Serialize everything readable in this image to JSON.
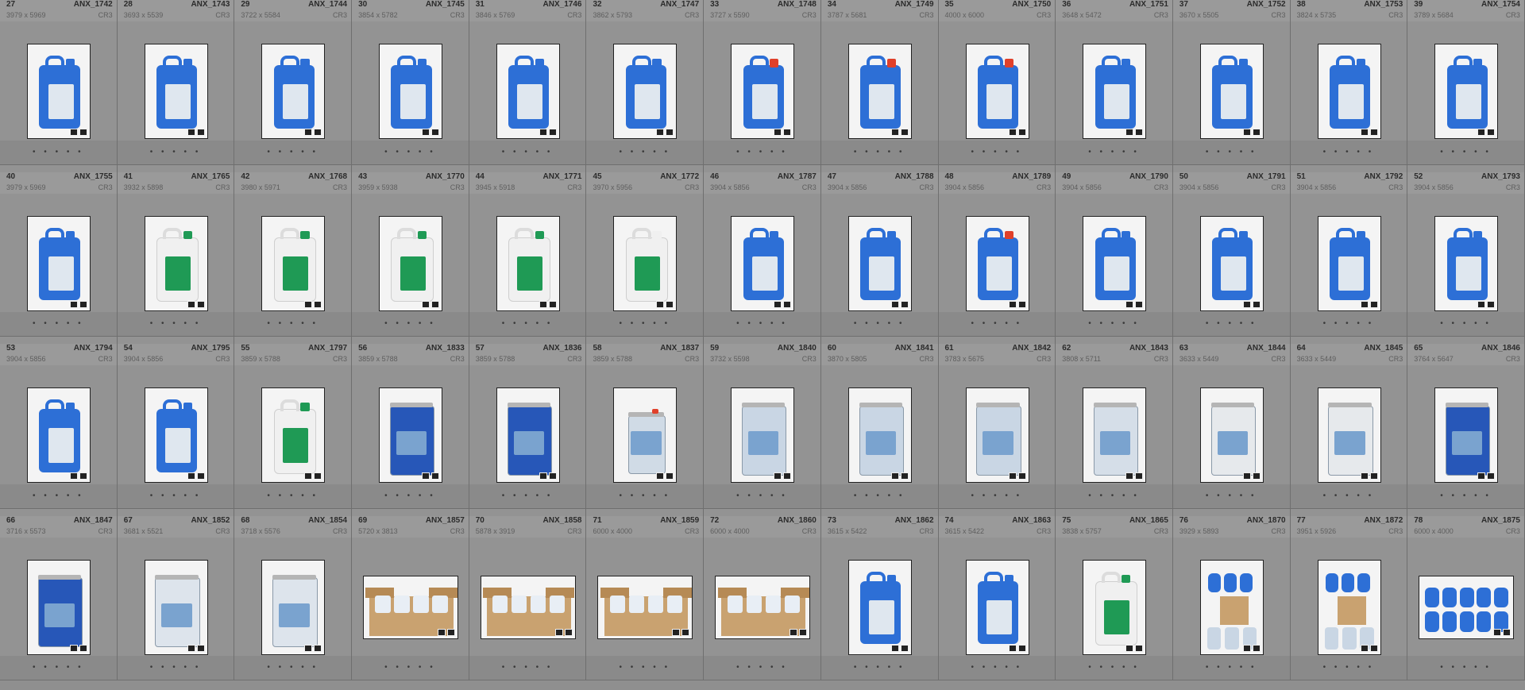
{
  "items": [
    {
      "num": "27",
      "file": "ANX_1742",
      "dims": "3979 x 5969",
      "ext": "CR3",
      "kind": "canister",
      "color": "#2d6fd6",
      "cap": "#2d6fd6",
      "orient": "portrait"
    },
    {
      "num": "28",
      "file": "ANX_1743",
      "dims": "3693 x 5539",
      "ext": "CR3",
      "kind": "canister",
      "color": "#2d6fd6",
      "cap": "#2d6fd6",
      "orient": "portrait"
    },
    {
      "num": "29",
      "file": "ANX_1744",
      "dims": "3722 x 5584",
      "ext": "CR3",
      "kind": "canister",
      "color": "#2d6fd6",
      "cap": "#2d6fd6",
      "orient": "portrait"
    },
    {
      "num": "30",
      "file": "ANX_1745",
      "dims": "3854 x 5782",
      "ext": "CR3",
      "kind": "canister",
      "color": "#2d6fd6",
      "cap": "#2d6fd6",
      "orient": "portrait"
    },
    {
      "num": "31",
      "file": "ANX_1746",
      "dims": "3846 x 5769",
      "ext": "CR3",
      "kind": "canister",
      "color": "#2d6fd6",
      "cap": "#2d6fd6",
      "orient": "portrait"
    },
    {
      "num": "32",
      "file": "ANX_1747",
      "dims": "3862 x 5793",
      "ext": "CR3",
      "kind": "canister",
      "color": "#2d6fd6",
      "cap": "#2d6fd6",
      "orient": "portrait"
    },
    {
      "num": "33",
      "file": "ANX_1748",
      "dims": "3727 x 5590",
      "ext": "CR3",
      "kind": "canister",
      "color": "#2d6fd6",
      "cap": "#e0402a",
      "orient": "portrait"
    },
    {
      "num": "34",
      "file": "ANX_1749",
      "dims": "3787 x 5681",
      "ext": "CR3",
      "kind": "canister",
      "color": "#2d6fd6",
      "cap": "#e0402a",
      "orient": "portrait"
    },
    {
      "num": "35",
      "file": "ANX_1750",
      "dims": "4000 x 6000",
      "ext": "CR3",
      "kind": "canister",
      "color": "#2d6fd6",
      "cap": "#e0402a",
      "orient": "portrait"
    },
    {
      "num": "36",
      "file": "ANX_1751",
      "dims": "3648 x 5472",
      "ext": "CR3",
      "kind": "canister",
      "color": "#2d6fd6",
      "cap": "#2d6fd6",
      "orient": "portrait"
    },
    {
      "num": "37",
      "file": "ANX_1752",
      "dims": "3670 x 5505",
      "ext": "CR3",
      "kind": "canister",
      "color": "#2d6fd6",
      "cap": "#2d6fd6",
      "orient": "portrait"
    },
    {
      "num": "38",
      "file": "ANX_1753",
      "dims": "3824 x 5735",
      "ext": "CR3",
      "kind": "canister",
      "color": "#2d6fd6",
      "cap": "#2d6fd6",
      "orient": "portrait"
    },
    {
      "num": "39",
      "file": "ANX_1754",
      "dims": "3789 x 5684",
      "ext": "CR3",
      "kind": "canister",
      "color": "#2d6fd6",
      "cap": "#2d6fd6",
      "orient": "portrait"
    },
    {
      "num": "40",
      "file": "ANX_1755",
      "dims": "3979 x 5969",
      "ext": "CR3",
      "kind": "canister",
      "color": "#2d6fd6",
      "cap": "#2d6fd6",
      "orient": "portrait"
    },
    {
      "num": "41",
      "file": "ANX_1765",
      "dims": "3932 x 5898",
      "ext": "CR3",
      "kind": "canister-white",
      "color": "#f0f0f0",
      "cap": "#1f9a55",
      "orient": "portrait"
    },
    {
      "num": "42",
      "file": "ANX_1768",
      "dims": "3980 x 5971",
      "ext": "CR3",
      "kind": "canister-white",
      "color": "#f0f0f0",
      "cap": "#1f9a55",
      "orient": "portrait"
    },
    {
      "num": "43",
      "file": "ANX_1770",
      "dims": "3959 x 5938",
      "ext": "CR3",
      "kind": "canister-white",
      "color": "#f0f0f0",
      "cap": "#1f9a55",
      "orient": "portrait"
    },
    {
      "num": "44",
      "file": "ANX_1771",
      "dims": "3945 x 5918",
      "ext": "CR3",
      "kind": "canister-white",
      "color": "#f0f0f0",
      "cap": "#1f9a55",
      "orient": "portrait"
    },
    {
      "num": "45",
      "file": "ANX_1772",
      "dims": "3970 x 5956",
      "ext": "CR3",
      "kind": "canister-white",
      "color": "#f0f0f0",
      "cap": "#f0f0f0",
      "orient": "portrait"
    },
    {
      "num": "46",
      "file": "ANX_1787",
      "dims": "3904 x 5856",
      "ext": "CR3",
      "kind": "canister",
      "color": "#2d6fd6",
      "cap": "#2d6fd6",
      "orient": "portrait"
    },
    {
      "num": "47",
      "file": "ANX_1788",
      "dims": "3904 x 5856",
      "ext": "CR3",
      "kind": "canister",
      "color": "#2d6fd6",
      "cap": "#2d6fd6",
      "orient": "portrait"
    },
    {
      "num": "48",
      "file": "ANX_1789",
      "dims": "3904 x 5856",
      "ext": "CR3",
      "kind": "canister",
      "color": "#2d6fd6",
      "cap": "#e0402a",
      "orient": "portrait"
    },
    {
      "num": "49",
      "file": "ANX_1790",
      "dims": "3904 x 5856",
      "ext": "CR3",
      "kind": "canister",
      "color": "#2d6fd6",
      "cap": "#2d6fd6",
      "orient": "portrait"
    },
    {
      "num": "50",
      "file": "ANX_1791",
      "dims": "3904 x 5856",
      "ext": "CR3",
      "kind": "canister",
      "color": "#2d6fd6",
      "cap": "#2d6fd6",
      "orient": "portrait"
    },
    {
      "num": "51",
      "file": "ANX_1792",
      "dims": "3904 x 5856",
      "ext": "CR3",
      "kind": "canister",
      "color": "#2d6fd6",
      "cap": "#2d6fd6",
      "orient": "portrait"
    },
    {
      "num": "52",
      "file": "ANX_1793",
      "dims": "3904 x 5856",
      "ext": "CR3",
      "kind": "canister",
      "color": "#2d6fd6",
      "cap": "#2d6fd6",
      "orient": "portrait"
    },
    {
      "num": "53",
      "file": "ANX_1794",
      "dims": "3904 x 5856",
      "ext": "CR3",
      "kind": "canister",
      "color": "#2d6fd6",
      "cap": "#2d6fd6",
      "orient": "portrait"
    },
    {
      "num": "54",
      "file": "ANX_1795",
      "dims": "3904 x 5856",
      "ext": "CR3",
      "kind": "canister",
      "color": "#2d6fd6",
      "cap": "#2d6fd6",
      "orient": "portrait"
    },
    {
      "num": "55",
      "file": "ANX_1797",
      "dims": "3859 x 5788",
      "ext": "CR3",
      "kind": "canister-white",
      "color": "#f0f0f0",
      "cap": "#1f9a55",
      "orient": "portrait"
    },
    {
      "num": "56",
      "file": "ANX_1833",
      "dims": "3859 x 5788",
      "ext": "CR3",
      "kind": "tin",
      "color": "#2757b8",
      "cap": "#b8b8b8",
      "orient": "portrait"
    },
    {
      "num": "57",
      "file": "ANX_1836",
      "dims": "3859 x 5788",
      "ext": "CR3",
      "kind": "tin",
      "color": "#2757b8",
      "cap": "#b8b8b8",
      "orient": "portrait"
    },
    {
      "num": "58",
      "file": "ANX_1837",
      "dims": "3859 x 5788",
      "ext": "CR3",
      "kind": "tin-small",
      "color": "#d0dbe6",
      "cap": "#e0402a",
      "orient": "portrait"
    },
    {
      "num": "59",
      "file": "ANX_1840",
      "dims": "3732 x 5598",
      "ext": "CR3",
      "kind": "tin",
      "color": "#c9d6e4",
      "cap": "#b8b8b8",
      "orient": "portrait"
    },
    {
      "num": "60",
      "file": "ANX_1841",
      "dims": "3870 x 5805",
      "ext": "CR3",
      "kind": "tin",
      "color": "#c9d6e4",
      "cap": "#b8b8b8",
      "orient": "portrait"
    },
    {
      "num": "61",
      "file": "ANX_1842",
      "dims": "3783 x 5675",
      "ext": "CR3",
      "kind": "tin",
      "color": "#c9d6e4",
      "cap": "#b8b8b8",
      "orient": "portrait"
    },
    {
      "num": "62",
      "file": "ANX_1843",
      "dims": "3808 x 5711",
      "ext": "CR3",
      "kind": "tin",
      "color": "#d5dee8",
      "cap": "#b8b8b8",
      "orient": "portrait"
    },
    {
      "num": "63",
      "file": "ANX_1844",
      "dims": "3633 x 5449",
      "ext": "CR3",
      "kind": "tin",
      "color": "#e6e9ec",
      "cap": "#b8b8b8",
      "orient": "portrait"
    },
    {
      "num": "64",
      "file": "ANX_1845",
      "dims": "3633 x 5449",
      "ext": "CR3",
      "kind": "tin",
      "color": "#e6e9ec",
      "cap": "#b8b8b8",
      "orient": "portrait"
    },
    {
      "num": "65",
      "file": "ANX_1846",
      "dims": "3764 x 5647",
      "ext": "CR3",
      "kind": "tin",
      "color": "#2757b8",
      "cap": "#b8b8b8",
      "orient": "portrait"
    },
    {
      "num": "66",
      "file": "ANX_1847",
      "dims": "3716 x 5573",
      "ext": "CR3",
      "kind": "tin",
      "color": "#2757b8",
      "cap": "#b8b8b8",
      "orient": "portrait"
    },
    {
      "num": "67",
      "file": "ANX_1852",
      "dims": "3681 x 5521",
      "ext": "CR3",
      "kind": "tin",
      "color": "#dde4ec",
      "cap": "#b8b8b8",
      "orient": "portrait"
    },
    {
      "num": "68",
      "file": "ANX_1854",
      "dims": "3718 x 5576",
      "ext": "CR3",
      "kind": "tin",
      "color": "#dde4ec",
      "cap": "#b8b8b8",
      "orient": "portrait"
    },
    {
      "num": "69",
      "file": "ANX_1857",
      "dims": "5720 x 3813",
      "ext": "CR3",
      "kind": "box",
      "color": "#c9a270",
      "cap": "#c9a270",
      "orient": "landscape"
    },
    {
      "num": "70",
      "file": "ANX_1858",
      "dims": "5878 x 3919",
      "ext": "CR3",
      "kind": "box",
      "color": "#c9a270",
      "cap": "#c9a270",
      "orient": "landscape"
    },
    {
      "num": "71",
      "file": "ANX_1859",
      "dims": "6000 x 4000",
      "ext": "CR3",
      "kind": "box",
      "color": "#c9a270",
      "cap": "#c9a270",
      "orient": "landscape"
    },
    {
      "num": "72",
      "file": "ANX_1860",
      "dims": "6000 x 4000",
      "ext": "CR3",
      "kind": "box",
      "color": "#c9a270",
      "cap": "#c9a270",
      "orient": "landscape"
    },
    {
      "num": "73",
      "file": "ANX_1862",
      "dims": "3615 x 5422",
      "ext": "CR3",
      "kind": "canister",
      "color": "#2d6fd6",
      "cap": "#2d6fd6",
      "orient": "portrait"
    },
    {
      "num": "74",
      "file": "ANX_1863",
      "dims": "3615 x 5422",
      "ext": "CR3",
      "kind": "canister",
      "color": "#2d6fd6",
      "cap": "#2d6fd6",
      "orient": "portrait"
    },
    {
      "num": "75",
      "file": "ANX_1865",
      "dims": "3838 x 5757",
      "ext": "CR3",
      "kind": "canister-white",
      "color": "#f0f0f0",
      "cap": "#1f9a55",
      "orient": "portrait"
    },
    {
      "num": "76",
      "file": "ANX_1870",
      "dims": "3929 x 5893",
      "ext": "CR3",
      "kind": "group",
      "color": "#2d6fd6",
      "cap": "#c9a270",
      "orient": "portrait"
    },
    {
      "num": "77",
      "file": "ANX_1872",
      "dims": "3951 x 5926",
      "ext": "CR3",
      "kind": "group",
      "color": "#2d6fd6",
      "cap": "#c9a270",
      "orient": "portrait"
    },
    {
      "num": "78",
      "file": "ANX_1875",
      "dims": "6000 x 4000",
      "ext": "CR3",
      "kind": "lineup",
      "color": "#2d6fd6",
      "cap": "#2d6fd6",
      "orient": "landscape"
    }
  ]
}
